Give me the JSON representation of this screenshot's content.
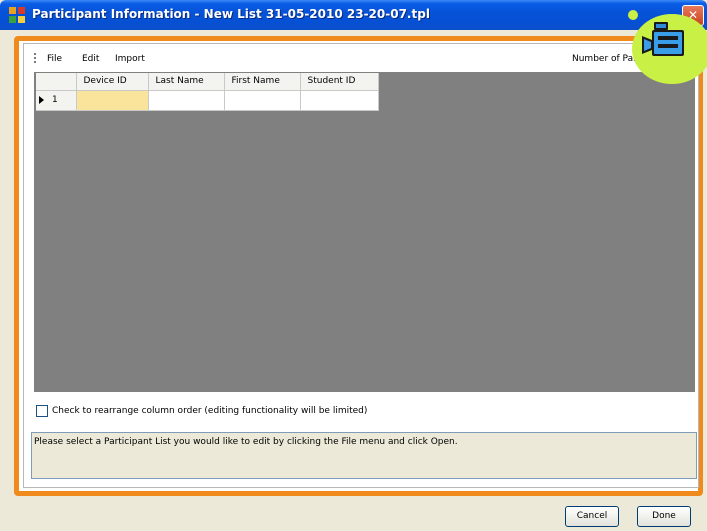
{
  "window": {
    "title": "Participant Information - New List 31-05-2010 23-20-07.tpl"
  },
  "menu": {
    "items": [
      "File",
      "Edit",
      "Import"
    ],
    "right_label": "Number of Par"
  },
  "grid": {
    "columns": [
      "Device ID",
      "Last Name",
      "First Name",
      "Student ID"
    ],
    "rows": [
      {
        "index": "1",
        "cells": [
          "",
          "",
          "",
          ""
        ]
      }
    ]
  },
  "options": {
    "rearrange_label": "Check to rearrange column order (editing functionality will be limited)"
  },
  "status": {
    "message": "Please select a Participant List you would like to edit by clicking the File menu and click Open."
  },
  "buttons": {
    "cancel": "Cancel",
    "done": "Done"
  },
  "icons": {
    "app": "app-grid-icon",
    "close": "close-icon",
    "camera": "video-camera-icon"
  },
  "colors": {
    "accent": "#f08a1c",
    "titlebar": "#0753d8",
    "selected_cell": "#fae49c",
    "grid_background": "#808080"
  }
}
